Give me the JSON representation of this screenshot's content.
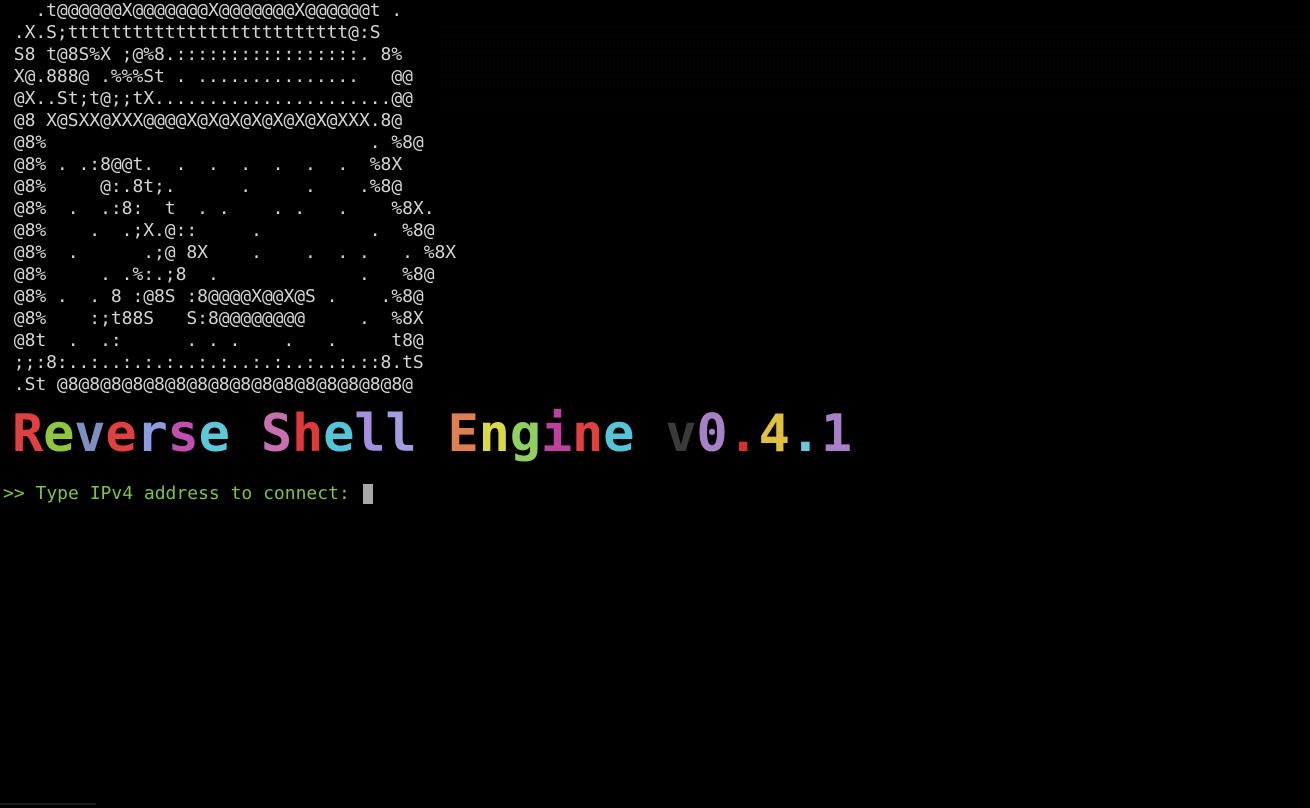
{
  "terminal": {
    "ascii_art": [
      "   .t@@@@@@X@@@@@@@X@@@@@@@X@@@@@@t .",
      " .X.S;tttttttttttttttttttttttttt@:S",
      " S8 t@8S%X ;@%8.:::::::::::::::::. 8%",
      " X@.888@ .%%%St . ...............   @@",
      " @X..St;t@;;tX......................@@",
      " @8 X@SXX@XXX@@@@X@X@X@X@X@X@X@XXX.8@",
      " @8%                              . %8@",
      " @8% . .:8@@t.  .  .  .  .  .  .  %8X",
      " @8%     @:.8t;.      .     .    .%8@",
      " @8%  .  .:8:  t  . .    . .   .    %8X.",
      " @8%    .  .;X.@::     .          .  %8@",
      " @8%  .      .;@ 8X    .    .  . .   . %8X",
      " @8%     . .%:.;8  .             .   %8@",
      " @8% .  . 8 :@8S :8@@@@X@@X@S .    .%8@",
      " @8%    :;t88S   S:8@@@@@@@@     .  %8X",
      " @8t  .  .:      . . .    .   .     t8@",
      " ;;:8:..:..:.:.:..:.:..:.:..:..:.::8.tS",
      " .St @8@8@8@8@8@8@8@8@8@8@8@8@8@8@8@8@"
    ],
    "banner": {
      "text": "Reverse Shell Engine v0.4.1",
      "colors": [
        "#e04040",
        "#8ec640",
        "#7f8fc0",
        "#e04040",
        "#8e9be0",
        "#c04fb0",
        "#5fc8d8",
        "#3a3a3a",
        "#c86fb0",
        "#e03838",
        "#56c4d8",
        "#a78fe0",
        "#a0a0e0",
        "#3a3a3a",
        "#e08050",
        "#d8d848",
        "#8fd060",
        "#c040a0",
        "#e04040",
        "#56c4d8",
        "#d0d060",
        "#3a3a3a",
        "#a880c8",
        "#d83030",
        "#e0c040",
        "#6cc8e0",
        "#a880c8",
        "#d83030"
      ]
    },
    "prompt": {
      "text": ">> Type IPv4 address to connect: "
    },
    "colors": {
      "background": "#000000",
      "ascii_fg": "#d4d4d4",
      "prompt_fg": "#7ec24a",
      "cursor": "#a8a8a8"
    }
  }
}
